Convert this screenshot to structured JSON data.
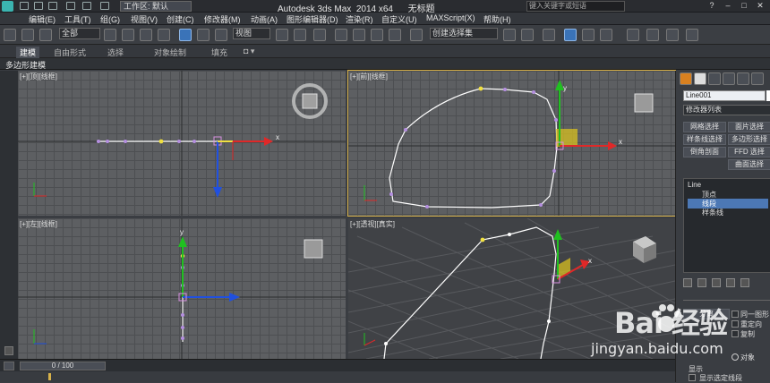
{
  "titlebar": {
    "workspace_label": "工作区: 默认",
    "app_title": "Autodesk 3ds Max  2014 x64      无标题",
    "search_placeholder": "键入关键字或短语"
  },
  "menu": [
    "编辑(E)",
    "工具(T)",
    "组(G)",
    "视图(V)",
    "创建(C)",
    "修改器(M)",
    "动画(A)",
    "图形编辑器(D)",
    "渲染(R)",
    "自定义(U)",
    "MAXScript(X)",
    "帮助(H)"
  ],
  "toolbar": {
    "filter_value": "全部",
    "coord_value": "视图",
    "named_selection_value": "创建选择集"
  },
  "ribbon": {
    "tabs": [
      "建模",
      "自由形式",
      "选择",
      "对象绘制",
      "填充"
    ],
    "active_tab": "建模",
    "subpanel_label": "多边形建模"
  },
  "viewports": {
    "top_left_label": "[+][顶][线框]",
    "top_right_label": "[+][前][线框]",
    "bottom_left_label": "[+][左][线框]",
    "bottom_right_label": "[+][透视][真实]",
    "axis_x": "x",
    "axis_y": "y"
  },
  "timeline": {
    "slider_text": "0 / 100"
  },
  "command_panel": {
    "object_name": "Line001",
    "modifier_list": "修改器列表",
    "buttons": [
      "网格选择",
      "面片选择",
      "样条线选择",
      "多边形选择",
      "倒角剖面",
      "FFD 选择",
      "曲面选择"
    ],
    "stack": {
      "root": "Line",
      "items": [
        "顶点",
        "线段",
        "样条线"
      ],
      "selected": "线段"
    },
    "rollout_title": "分离",
    "options": [
      "同一图形",
      "重定向",
      "复制"
    ],
    "label_copy": "对象",
    "display_title": "显示",
    "display_option": "显示选定线段"
  },
  "colors": {
    "accent_selection": "#4c78b5",
    "active_viewport_border": "#d8b24a",
    "spline_white": "#ffffff",
    "vertex_purple": "#b58fe0",
    "vertex_yellow": "#f0e040",
    "gizmo_red": "#e02828",
    "gizmo_green": "#20c020",
    "gizmo_blue": "#2050e0"
  },
  "watermark": {
    "brand": "Bai  经验",
    "url": "jingyan.baidu.com"
  }
}
